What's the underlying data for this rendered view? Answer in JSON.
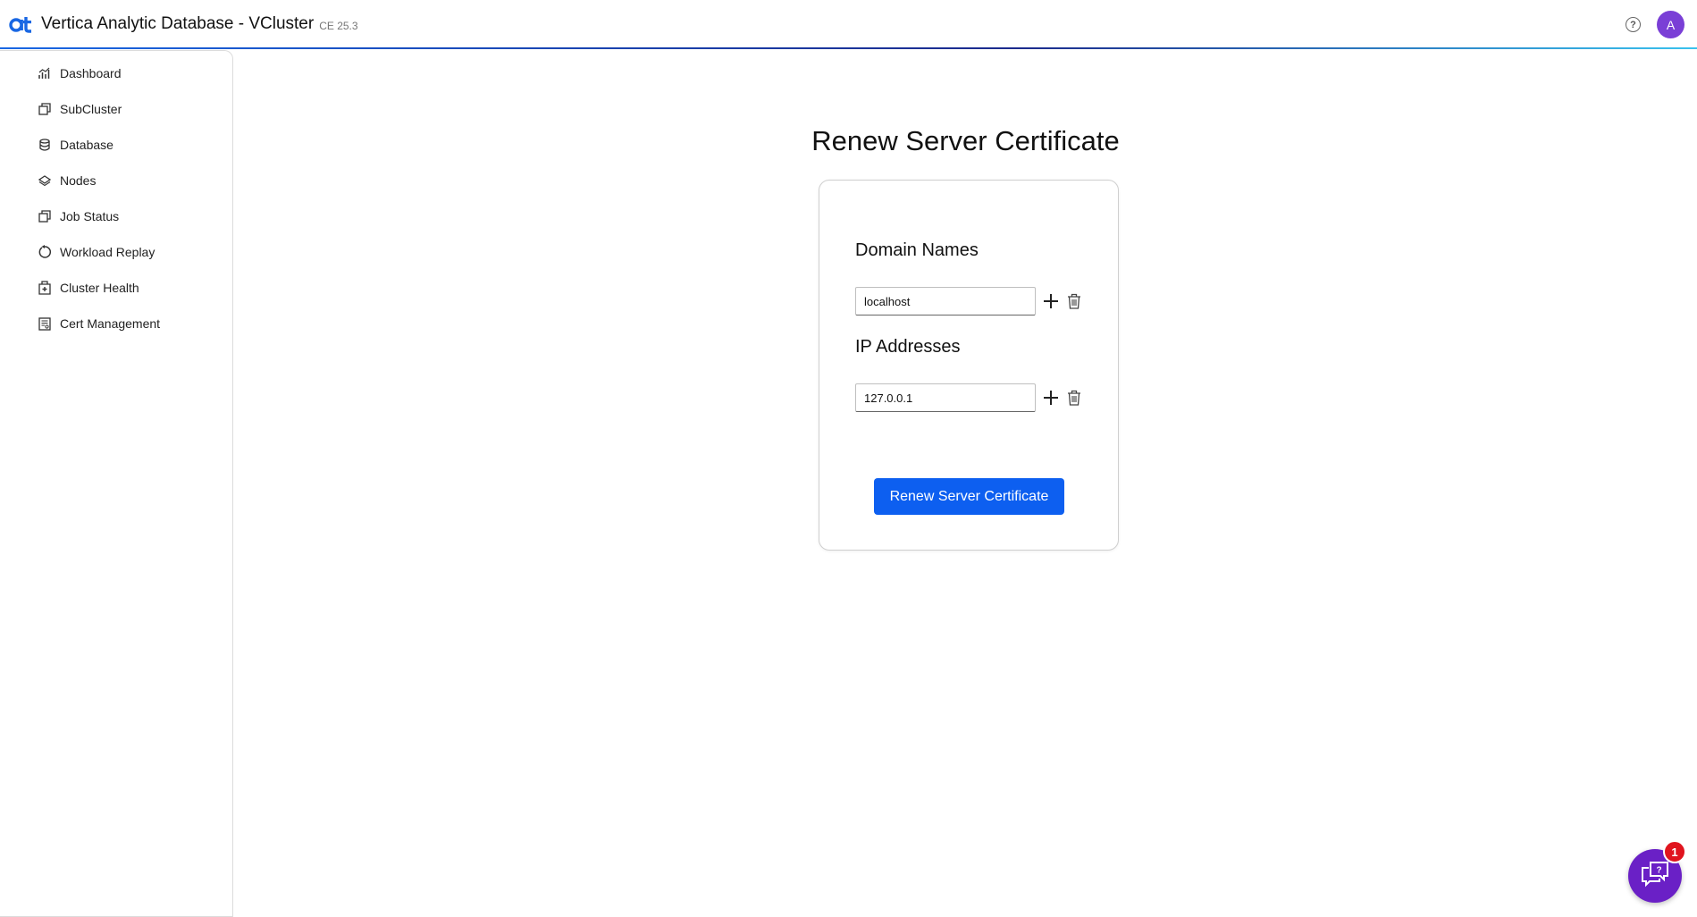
{
  "header": {
    "app_title": "Vertica Analytic Database - VCluster",
    "version": "CE 25.3",
    "avatar_initial": "A",
    "help_label": "?",
    "accent_color": "#1967e3"
  },
  "sidebar": {
    "items": [
      {
        "label": "Dashboard",
        "icon": "chart-icon"
      },
      {
        "label": "SubCluster",
        "icon": "copy-icon"
      },
      {
        "label": "Database",
        "icon": "database-icon"
      },
      {
        "label": "Nodes",
        "icon": "layers-icon"
      },
      {
        "label": "Job Status",
        "icon": "copy-icon"
      },
      {
        "label": "Workload Replay",
        "icon": "replay-icon"
      },
      {
        "label": "Cluster Health",
        "icon": "health-icon"
      },
      {
        "label": "Cert Management",
        "icon": "certificate-icon"
      }
    ]
  },
  "main": {
    "title": "Renew Server Certificate",
    "domain_section": {
      "title": "Domain Names",
      "value": "localhost"
    },
    "ip_section": {
      "title": "IP Addresses",
      "value": "127.0.0.1"
    },
    "submit_label": "Renew Server Certificate",
    "button_color": "#0d5ff0"
  },
  "chat": {
    "badge_count": "1",
    "color": "#6a20c6"
  }
}
